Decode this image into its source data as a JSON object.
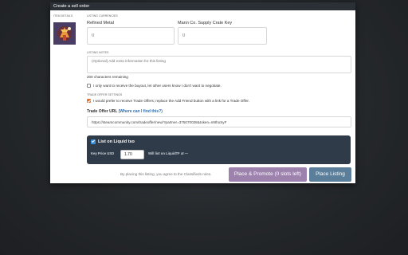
{
  "modal": {
    "title": "Create a sell order"
  },
  "item_details": {
    "label": "ITEM DETAILS"
  },
  "listing_currencies": {
    "label": "LISTING CURRENCIES",
    "refined": {
      "label": "Refined Metal",
      "placeholder": "0"
    },
    "crate_key": {
      "label": "Mann Co. Supply Crate Key",
      "placeholder": "0"
    }
  },
  "listing_notes": {
    "label": "LISTING NOTES",
    "placeholder": "(Optional) Add extra information for this listing",
    "remaining": "200 characters remaining"
  },
  "buyout": {
    "label": "I only want to receive the buyout, let other users know I don't want to negotiate.",
    "checked": false
  },
  "trade_offer_settings": {
    "label": "TRADE OFFER SETTINGS"
  },
  "trade_offers": {
    "label": "I would prefer to receive Trade Offers; replace the Add Friend button with a link for a Trade Offer.",
    "checked": true
  },
  "trade_url": {
    "label": "Trade Offer URL",
    "help": "(Where can I find this?)",
    "value": "https://steamcommunity.com/tradeoffer/new/?partner=375070028&token=n9thoSyF"
  },
  "liquid": {
    "label": "List on Liquid tso",
    "checked": true,
    "key_price_label": "Key Price USD",
    "key_price_value": "1.70",
    "note": "Will list on LiquidTF at —"
  },
  "footer": {
    "rules_text": "By placing this listing, you agree to the Classifieds rules.",
    "promote_button": "Place & Promote (0 slots left)",
    "place_button": "Place Listing"
  },
  "colors": {
    "promote": "#9c82ad",
    "place": "#5b7f9a",
    "accent": "#e8702a"
  },
  "icons": {
    "item": "item-image",
    "checkbox": "checkmark"
  }
}
